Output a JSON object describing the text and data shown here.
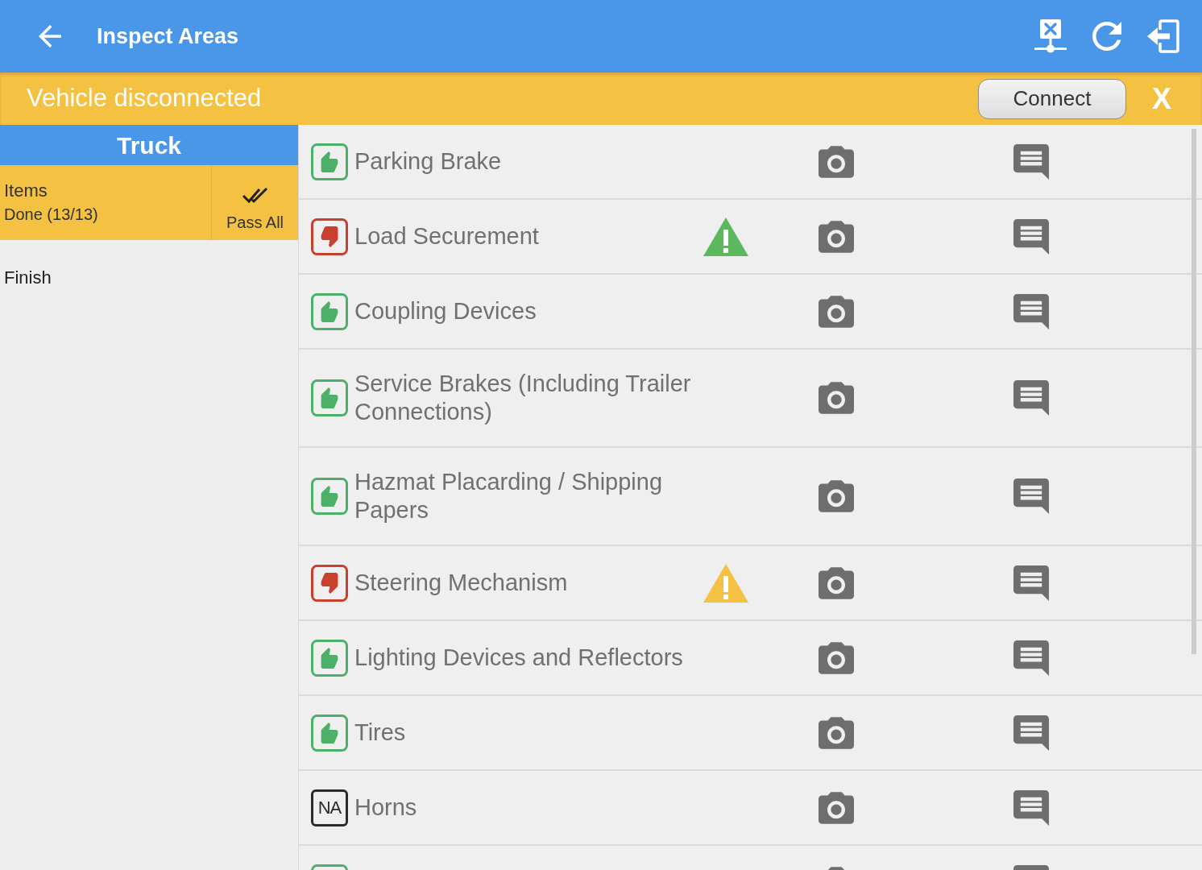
{
  "app_bar": {
    "title": "Inspect Areas"
  },
  "banner": {
    "message": "Vehicle disconnected",
    "button": "Connect",
    "close": "X"
  },
  "sidebar": {
    "header": "Truck",
    "summary_label": "Items",
    "progress": "Done (13/13)",
    "action": "Pass All",
    "finish": "Finish"
  },
  "inspection_items": [
    {
      "name": "Parking Brake",
      "kind": "pass"
    },
    {
      "name": "Load Securement",
      "kind": "fail",
      "warning": {
        "color": "#5cb85c"
      }
    },
    {
      "name": "Coupling Devices",
      "kind": "pass"
    },
    {
      "name": "Service Brakes (Including Trailer Connections)",
      "kind": "pass"
    },
    {
      "name": "Hazmat Placarding / Shipping Papers",
      "kind": "pass"
    },
    {
      "name": "Steering Mechanism",
      "kind": "fail",
      "warning": {
        "color": "#f5c142"
      }
    },
    {
      "name": "Lighting Devices and Reflectors",
      "kind": "pass"
    },
    {
      "name": "Tires",
      "kind": "pass"
    },
    {
      "name": "Horns",
      "kind": "na",
      "status_label": "NA"
    },
    {
      "kind": "pass"
    }
  ]
}
